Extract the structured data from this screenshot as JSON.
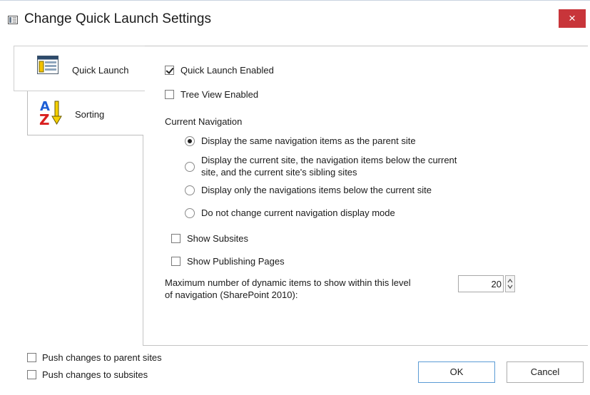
{
  "window": {
    "title": "Change Quick Launch Settings",
    "close_glyph": "×",
    "title_icon": "list-settings-icon"
  },
  "tabs": [
    {
      "label": "Quick Launch",
      "icon": "quick-launch-icon",
      "selected": true
    },
    {
      "label": "Sorting",
      "icon": "sort-az-icon",
      "selected": false
    }
  ],
  "quick_launch": {
    "quick_launch_enabled": {
      "label": "Quick Launch Enabled",
      "checked": true
    },
    "tree_view_enabled": {
      "label": "Tree View Enabled",
      "checked": false
    },
    "current_navigation": {
      "heading": "Current Navigation",
      "options": [
        {
          "label": "Display the same navigation items as the parent site",
          "selected": true
        },
        {
          "label_line1": "Display the current site, the navigation items below the current",
          "label_line2": "site, and the current site's sibling sites",
          "selected": false
        },
        {
          "label": "Display only the navigations items below the current site",
          "selected": false
        },
        {
          "label": "Do not change current navigation display mode",
          "selected": false
        }
      ]
    },
    "show_subsites": {
      "label": "Show Subsites",
      "checked": false
    },
    "show_publishing_pages": {
      "label": "Show Publishing Pages",
      "checked": false
    },
    "max_items": {
      "label_line1": "Maximum number of dynamic items to show within this level",
      "label_line2": "of navigation (SharePoint 2010):",
      "value": "20"
    }
  },
  "footer": {
    "push_parent": {
      "label": "Push changes to parent sites",
      "checked": false
    },
    "push_subsites": {
      "label": "Push changes to subsites",
      "checked": false
    },
    "ok_label": "OK",
    "cancel_label": "Cancel"
  },
  "colors": {
    "close_button": "#c8353a",
    "ok_border": "#5b9bd5",
    "sort_a": "#1e5fd6",
    "sort_z": "#d92020",
    "sort_arrow": "#e8b800"
  }
}
